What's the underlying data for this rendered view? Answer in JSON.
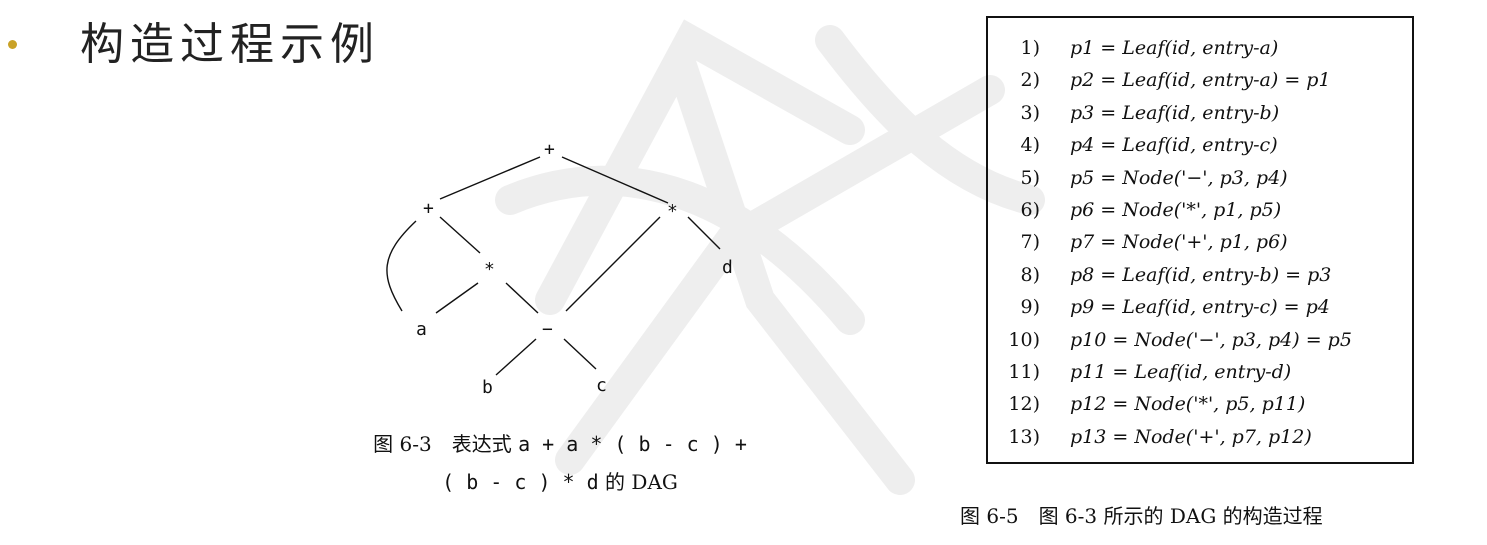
{
  "slide": {
    "title": "构造过程示例"
  },
  "dag": {
    "nodes": [
      {
        "id": "plus-root",
        "label": "+"
      },
      {
        "id": "plus-left",
        "label": "+"
      },
      {
        "id": "times-right",
        "label": "*"
      },
      {
        "id": "times-mid",
        "label": "*"
      },
      {
        "id": "leaf-d",
        "label": "d"
      },
      {
        "id": "leaf-a",
        "label": "a"
      },
      {
        "id": "minus",
        "label": "−"
      },
      {
        "id": "leaf-b",
        "label": "b"
      },
      {
        "id": "leaf-c",
        "label": "c"
      }
    ],
    "caption_line1_prefix": "图 6-3　表达式",
    "caption_line1_expr": "a + a * ( b - c ) +",
    "caption_line2_expr": "( b - c ) * d",
    "caption_line2_suffix": "的 DAG"
  },
  "steps": [
    {
      "num": "1)",
      "expr": "p1 = Leaf(id, entry-a)"
    },
    {
      "num": "2)",
      "expr": "p2 = Leaf(id, entry-a) = p1"
    },
    {
      "num": "3)",
      "expr": "p3 = Leaf(id, entry-b)"
    },
    {
      "num": "4)",
      "expr": "p4 = Leaf(id, entry-c)"
    },
    {
      "num": "5)",
      "expr": "p5 = Node('−', p3, p4)"
    },
    {
      "num": "6)",
      "expr": "p6 = Node('*', p1, p5)"
    },
    {
      "num": "7)",
      "expr": "p7 = Node('+', p1, p6)"
    },
    {
      "num": "8)",
      "expr": "p8 = Leaf(id, entry-b) = p3"
    },
    {
      "num": "9)",
      "expr": "p9 = Leaf(id, entry-c) = p4"
    },
    {
      "num": "10)",
      "expr": "p10 = Node('−', p3, p4) = p5"
    },
    {
      "num": "11)",
      "expr": "p11 = Leaf(id, entry-d)"
    },
    {
      "num": "12)",
      "expr": "p12 = Node('*', p5, p11)"
    },
    {
      "num": "13)",
      "expr": "p13 = Node('+', p7, p12)"
    }
  ],
  "box_caption": "图 6-5　图 6-3 所示的 DAG 的构造过程",
  "colors": {
    "bullet": "#c9a227",
    "watermark": "#eeeeee",
    "ink": "#111111"
  }
}
